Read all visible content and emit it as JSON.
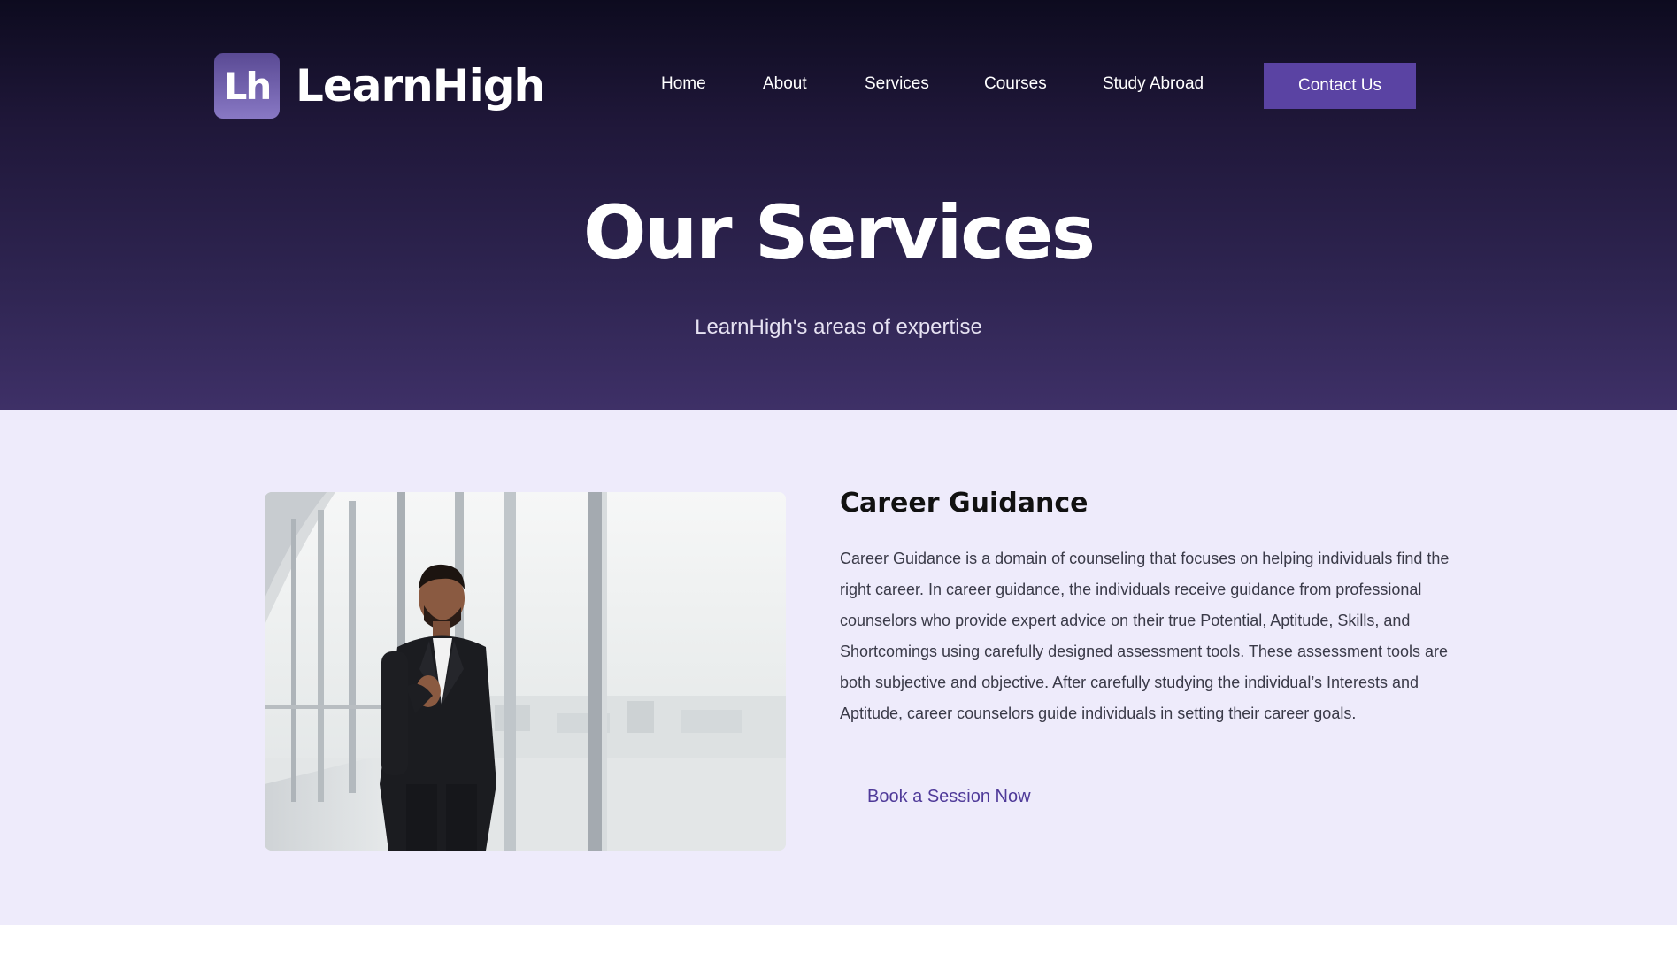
{
  "brand": {
    "logo_mark": "Lh",
    "name": "LearnHigh"
  },
  "nav": {
    "items": [
      "Home",
      "About",
      "Services",
      "Courses",
      "Study Abroad"
    ],
    "contact_label": "Contact Us"
  },
  "hero": {
    "title": "Our Services",
    "subtitle": "LearnHigh's areas of expertise"
  },
  "service": {
    "title": "Career Guidance",
    "description": "Career Guidance is a domain of counseling that focuses on helping individuals find the right career. In career guidance, the individuals receive guidance from professional counselors who provide expert advice on their true Potential, Aptitude, Skills, and Shortcomings using carefully designed assessment tools. These assessment tools are both subjective and objective. After carefully studying the individual’s Interests and Aptitude, career counselors guide individuals in setting their career goals.",
    "cta_label": "Book a Session Now"
  },
  "colors": {
    "hero_top": "#0d0b1f",
    "hero_bottom": "#3e3067",
    "accent": "#5a43a3",
    "content_bg": "#eeebfb",
    "link": "#4f3a99"
  }
}
